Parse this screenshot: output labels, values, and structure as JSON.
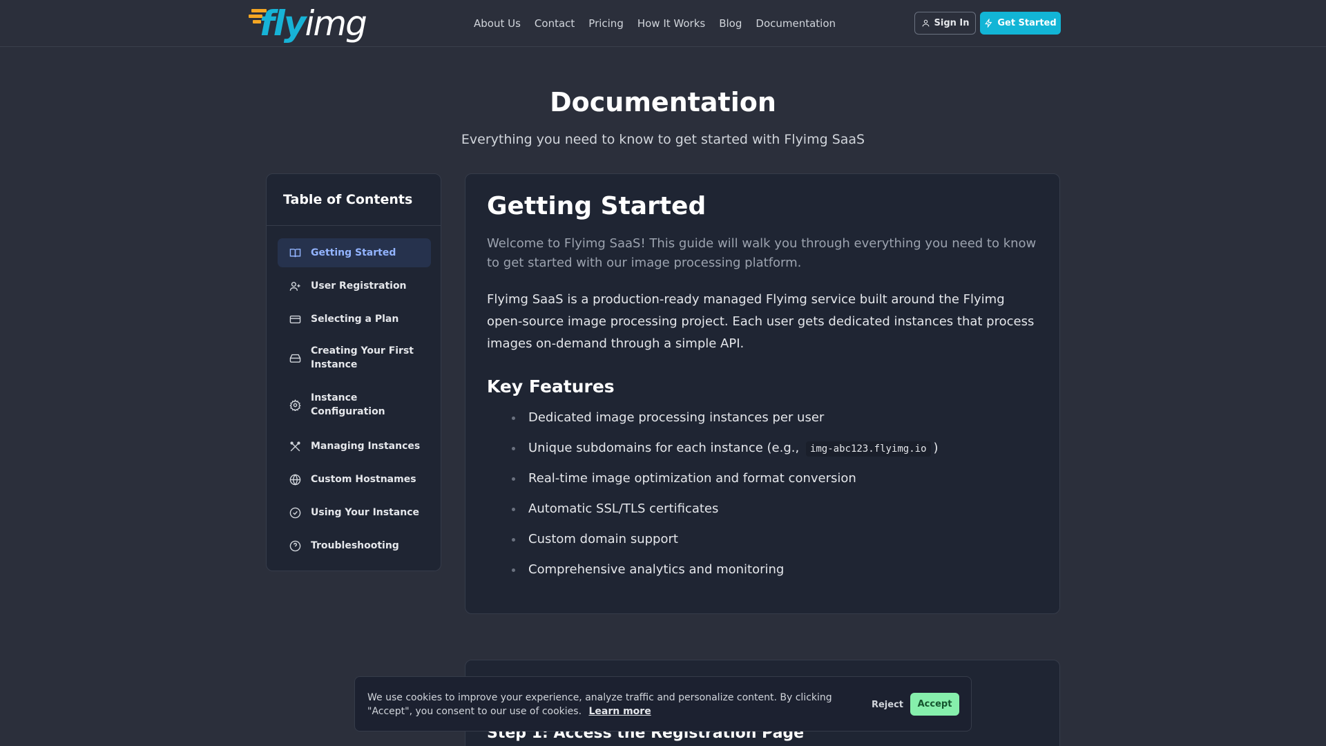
{
  "header": {
    "logo": {
      "part1": "fly",
      "part2": "img"
    },
    "nav": [
      "About Us",
      "Contact",
      "Pricing",
      "How It Works",
      "Blog",
      "Documentation"
    ],
    "signin_label": "Sign In",
    "getstarted_label": "Get Started",
    "accent_color": "#12b5d6"
  },
  "hero": {
    "title": "Documentation",
    "subtitle": "Everything you need to know to get started with Flyimg SaaS"
  },
  "toc": {
    "title": "Table of Contents",
    "items": [
      {
        "label": "Getting Started",
        "icon": "book-icon",
        "active": true
      },
      {
        "label": "User Registration",
        "icon": "user-plus-icon"
      },
      {
        "label": "Selecting a Plan",
        "icon": "credit-card-icon"
      },
      {
        "label": "Creating Your First Instance",
        "icon": "hard-drive-icon"
      },
      {
        "label": "Instance Configuration",
        "icon": "gear-icon"
      },
      {
        "label": "Managing Instances",
        "icon": "tools-icon"
      },
      {
        "label": "Custom Hostnames",
        "icon": "globe-icon"
      },
      {
        "label": "Using Your Instance",
        "icon": "check-circle-icon"
      },
      {
        "label": "Troubleshooting",
        "icon": "help-circle-icon"
      }
    ]
  },
  "main": {
    "title": "Getting Started",
    "intro": "Welcome to Flyimg SaaS! This guide will walk you through everything you need to know to get started with our image processing platform.",
    "paragraph": "Flyimg SaaS is a production-ready managed Flyimg service built around the Flyimg open-source image processing project. Each user gets dedicated instances that process images on-demand through a simple API.",
    "features_title": "Key Features",
    "features": [
      {
        "text": "Dedicated image processing instances per user"
      },
      {
        "text": "Unique subdomains for each instance (e.g.,",
        "code": "img-abc123.flyimg.io",
        "after": ")"
      },
      {
        "text": "Real-time image optimization and format conversion"
      },
      {
        "text": "Automatic SSL/TLS certificates"
      },
      {
        "text": "Custom domain support"
      },
      {
        "text": "Comprehensive analytics and monitoring"
      }
    ]
  },
  "section2": {
    "heading": "Step 1: Access the Registration Page"
  },
  "cookie": {
    "text": "We use cookies to improve your experience, analyze traffic and personalize content. By clicking \"Accept\", you consent to our use of cookies.",
    "link": "Learn more",
    "reject": "Reject",
    "accept": "Accept"
  }
}
